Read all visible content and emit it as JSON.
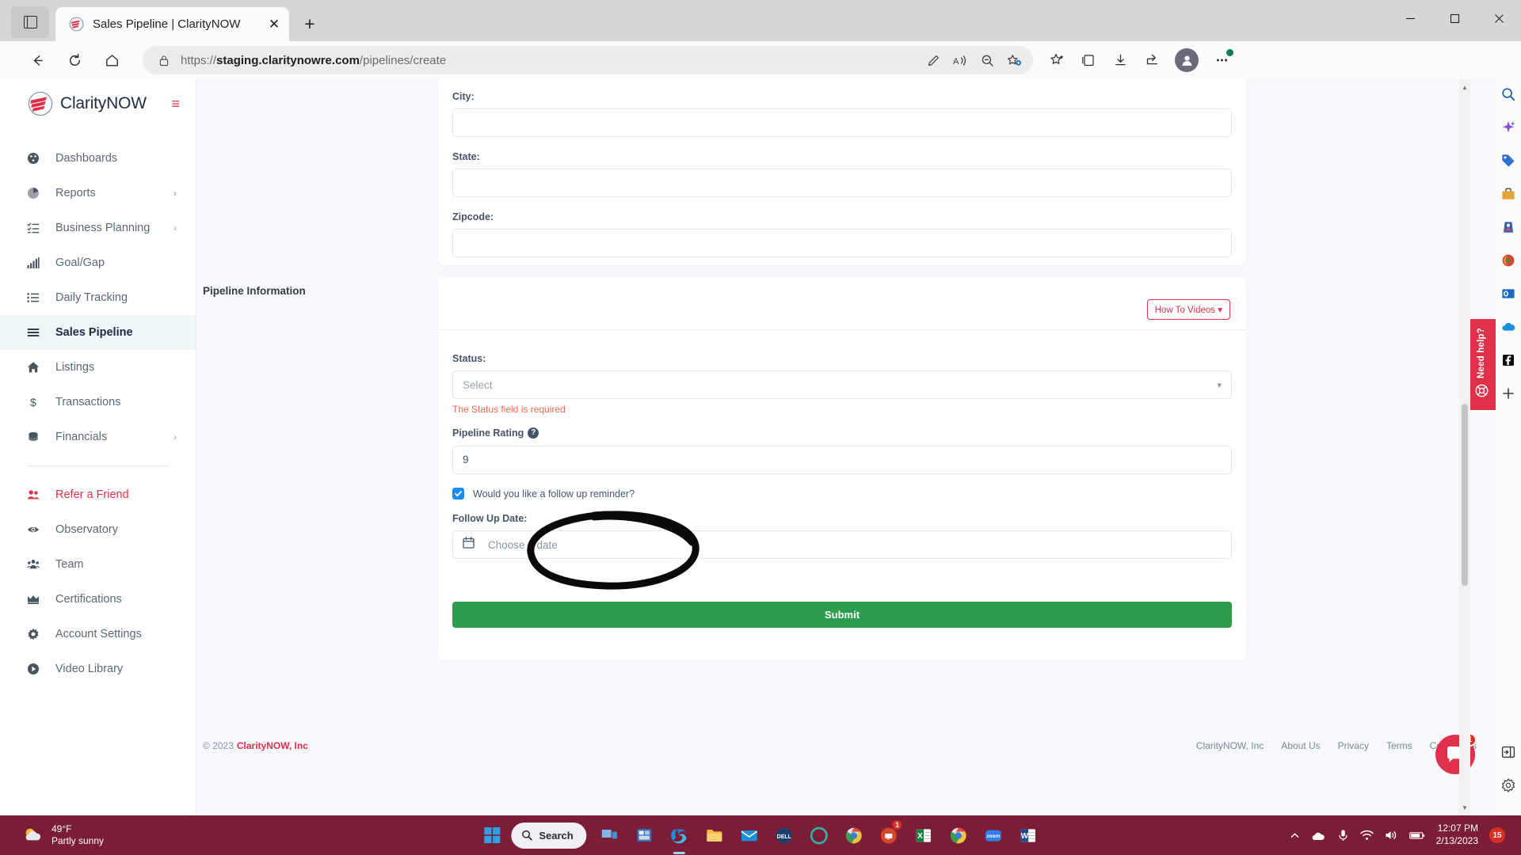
{
  "browser": {
    "tab": {
      "title": "Sales Pipeline | ClarityNOW",
      "favicon_name": "claritynow-favicon"
    },
    "new_tab_label": "+",
    "close_tab_label": "✕",
    "window_controls": {
      "minimize": "─",
      "maximize": "❐",
      "close": "✕"
    },
    "url_prefix": "https://",
    "url_domain": "staging.claritynowre.com",
    "url_path": "/pipelines/create",
    "ellipsis_badge": ""
  },
  "sidebar": {
    "brand": "ClarityNOW",
    "collapse_label": "≡",
    "items": [
      {
        "label": "Dashboards",
        "icon": "dashboard-icon",
        "active": false,
        "chevron": false
      },
      {
        "label": "Reports",
        "icon": "pie-chart-icon",
        "active": false,
        "chevron": true
      },
      {
        "label": "Business Planning",
        "icon": "task-list-icon",
        "active": false,
        "chevron": true
      },
      {
        "label": "Goal/Gap",
        "icon": "bar-chart-icon",
        "active": false,
        "chevron": false
      },
      {
        "label": "Daily Tracking",
        "icon": "list-icon",
        "active": false,
        "chevron": false
      },
      {
        "label": "Sales Pipeline",
        "icon": "pipeline-icon",
        "active": true,
        "chevron": false
      },
      {
        "label": "Listings",
        "icon": "home-icon",
        "active": false,
        "chevron": false
      },
      {
        "label": "Transactions",
        "icon": "dollar-icon",
        "active": false,
        "chevron": false
      },
      {
        "label": "Financials",
        "icon": "coins-icon",
        "active": false,
        "chevron": true
      }
    ],
    "items_secondary": [
      {
        "label": "Refer a Friend",
        "icon": "users-icon",
        "accent": true
      },
      {
        "label": "Observatory",
        "icon": "eye-icon",
        "accent": false
      },
      {
        "label": "Team",
        "icon": "team-icon",
        "accent": false
      },
      {
        "label": "Certifications",
        "icon": "crown-icon",
        "accent": false
      },
      {
        "label": "Account Settings",
        "icon": "gear-icon",
        "accent": false
      },
      {
        "label": "Video Library",
        "icon": "play-circle-icon",
        "accent": false
      }
    ]
  },
  "form": {
    "address_fields": [
      {
        "label": "City:",
        "value": "",
        "placeholder": ""
      },
      {
        "label": "State:",
        "value": "",
        "placeholder": ""
      },
      {
        "label": "Zipcode:",
        "value": "",
        "placeholder": ""
      }
    ],
    "pipeline_section_label": "Pipeline Information",
    "how_to_videos_label": "How To Videos",
    "how_to_videos_caret": "▾",
    "status": {
      "label": "Status:",
      "placeholder": "Select",
      "error": "The Status field is required"
    },
    "rating": {
      "label": "Pipeline Rating",
      "help_glyph": "?",
      "value": "9"
    },
    "follow_up_checkbox": {
      "label": "Would you like a follow up reminder?",
      "checked": true
    },
    "follow_up_date": {
      "label": "Follow Up Date:",
      "placeholder": "Choose a date"
    },
    "submit_label": "Submit"
  },
  "footer": {
    "copyright_prefix": "© 2023",
    "company": "ClarityNOW, Inc",
    "links": [
      "ClarityNOW, Inc",
      "About Us",
      "Privacy",
      "Terms",
      "Contact Us"
    ]
  },
  "need_help": {
    "text": "Need help?",
    "icon": "lifebuoy-icon"
  },
  "chat": {
    "badge": "1",
    "icon": "chat-icon"
  },
  "taskbar": {
    "weather": {
      "temperature": "49°F",
      "condition": "Partly sunny"
    },
    "search_label": "Search",
    "apps": [
      {
        "name": "task-view",
        "running": false,
        "badge": ""
      },
      {
        "name": "widgets",
        "running": false,
        "badge": ""
      },
      {
        "name": "microsoft-edge",
        "running": true,
        "badge": ""
      },
      {
        "name": "file-explorer",
        "running": false,
        "badge": ""
      },
      {
        "name": "mail",
        "running": false,
        "badge": ""
      },
      {
        "name": "dell-app",
        "running": false,
        "badge": ""
      },
      {
        "name": "teams-classic",
        "running": false,
        "badge": ""
      },
      {
        "name": "chrome-beta",
        "running": false,
        "badge": ""
      },
      {
        "name": "notification-app",
        "running": false,
        "badge": "1"
      },
      {
        "name": "excel",
        "running": false,
        "badge": ""
      },
      {
        "name": "chrome",
        "running": false,
        "badge": ""
      },
      {
        "name": "zoom",
        "running": false,
        "badge": ""
      },
      {
        "name": "word",
        "running": false,
        "badge": ""
      }
    ],
    "clock": {
      "time": "12:07 PM",
      "date": "2/13/2023"
    },
    "notification_count": "15"
  },
  "colors": {
    "brand_red": "#e0304a",
    "submit_green": "#2d9c4e",
    "error_salmon": "#f0674f",
    "checkbox_blue": "#1d8cf0",
    "taskbar": "#7b1d36",
    "active_nav_bg": "#eef6fa"
  }
}
